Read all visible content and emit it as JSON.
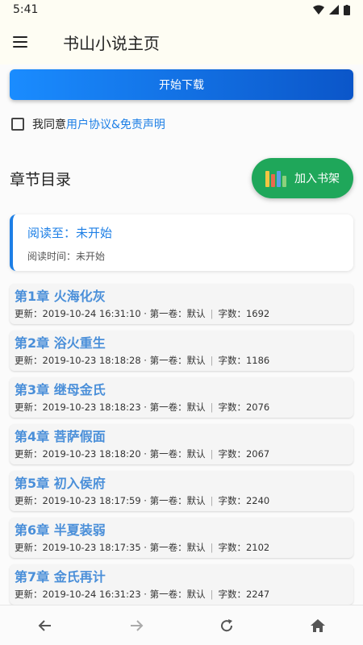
{
  "status": {
    "time": "5:41"
  },
  "header": {
    "title": "书山小说主页"
  },
  "download_label": "开始下载",
  "agreement": {
    "prefix": "我同意",
    "link": "用户协议&免责声明"
  },
  "catalog": {
    "title": "章节目录",
    "bookshelf_label": "加入书架"
  },
  "progress": {
    "reading_to": "阅读至：未开始",
    "reading_time": "阅读时间：未开始"
  },
  "chapters": [
    {
      "title": "第1章 火海化灰",
      "updated": "更新：2019-10-24 16:31:10 · 第一卷：默认",
      "words": "字数：1692"
    },
    {
      "title": "第2章 浴火重生",
      "updated": "更新：2019-10-23 18:18:28 · 第一卷：默认",
      "words": "字数：1186"
    },
    {
      "title": "第3章 继母金氏",
      "updated": "更新：2019-10-23 18:18:23 · 第一卷：默认",
      "words": "字数：2076"
    },
    {
      "title": "第4章 菩萨假面",
      "updated": "更新：2019-10-23 18:18:20 · 第一卷：默认",
      "words": "字数：2067"
    },
    {
      "title": "第5章 初入侯府",
      "updated": "更新：2019-10-23 18:17:59 · 第一卷：默认",
      "words": "字数：2240"
    },
    {
      "title": "第6章 半夏装弱",
      "updated": "更新：2019-10-23 18:17:35 · 第一卷：默认",
      "words": "字数：2102"
    },
    {
      "title": "第7章 金氏再计",
      "updated": "更新：2019-10-24 16:31:23 · 第一卷：默认",
      "words": "字数：2247"
    }
  ],
  "colors": {
    "accent": "#1d7fe6",
    "bookshelf": "#1fa75a",
    "chapter_title": "#4a8fd9"
  }
}
